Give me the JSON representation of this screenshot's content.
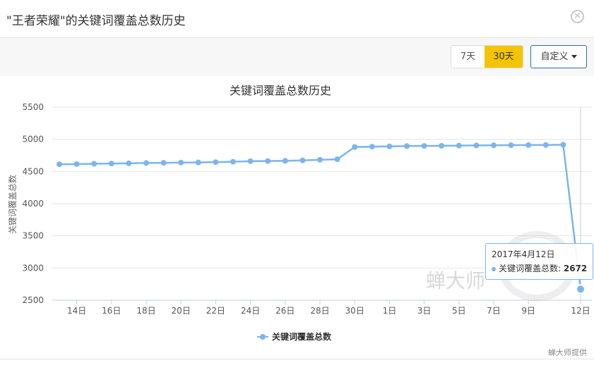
{
  "header": {
    "title": "\"王者荣耀\"的关键词覆盖总数历史",
    "close_icon": "close-circle-icon"
  },
  "toolbar": {
    "btn_7": "7天",
    "btn_30": "30天",
    "custom_label": "自定义"
  },
  "colors": {
    "series": "#7cb5ec",
    "active_btn": "#f5c400",
    "grid": "#e6e6e6"
  },
  "chart_data": {
    "type": "line",
    "title": "关键词覆盖总数历史",
    "ylabel": "关键词覆盖总数",
    "xlabel": "",
    "ylim": [
      2500,
      5500
    ],
    "yticks": [
      2500,
      3000,
      3500,
      4000,
      4500,
      5000,
      5500
    ],
    "x": [
      "3月13日",
      "3月14日",
      "3月15日",
      "3月16日",
      "3月17日",
      "3月18日",
      "3月19日",
      "3月20日",
      "3月21日",
      "3月22日",
      "3月23日",
      "3月24日",
      "3月25日",
      "3月26日",
      "3月27日",
      "3月28日",
      "3月29日",
      "3月30日",
      "3月31日",
      "4月1日",
      "4月2日",
      "4月3日",
      "4月4日",
      "4月5日",
      "4月6日",
      "4月7日",
      "4月8日",
      "4月9日",
      "4月10日",
      "4月11日",
      "4月12日"
    ],
    "xtick_labels": [
      "14日",
      "16日",
      "18日",
      "20日",
      "22日",
      "24日",
      "26日",
      "28日",
      "30日",
      "1日",
      "3日",
      "5日",
      "7日",
      "9日",
      "12日"
    ],
    "xtick_indices": [
      1,
      3,
      5,
      7,
      9,
      11,
      13,
      15,
      17,
      19,
      21,
      23,
      25,
      27,
      30
    ],
    "series": [
      {
        "name": "关键词覆盖总数",
        "values": [
          4612,
          4615,
          4620,
          4623,
          4627,
          4632,
          4634,
          4638,
          4640,
          4645,
          4652,
          4660,
          4662,
          4665,
          4672,
          4682,
          4690,
          4880,
          4886,
          4890,
          4895,
          4897,
          4899,
          4902,
          4905,
          4907,
          4909,
          4910,
          4912,
          4915,
          2672
        ]
      }
    ],
    "legend": "bottom-center",
    "grid": true,
    "tooltip": {
      "date": "2017年4月12日",
      "label": "关键词覆盖总数:",
      "value": "2672"
    }
  },
  "watermark": "蝉大师",
  "credit": "蝉大师提供"
}
